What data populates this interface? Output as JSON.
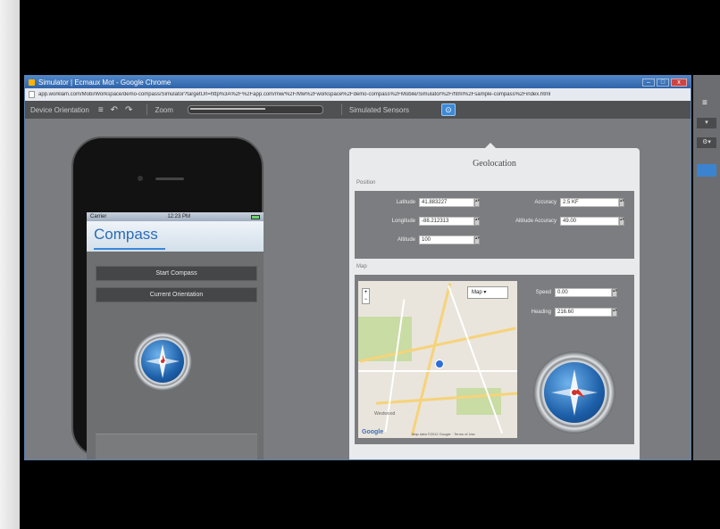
{
  "browser": {
    "title": "Simulator | Ecmaux Mot - Google Chrome",
    "url": "app.worklam.com/Mobi/Workspace/demo-compass/Simulator?targetUrl=http%3A%2F%2Fapp.com/mw/%2F/Mw%2Fworkspace%2Fdemo-compass%2FMobile/Simulator%2F/html%2Fsample-compass%2Findex.html",
    "win_min": "–",
    "win_max": "□",
    "win_close": "x"
  },
  "toolbar": {
    "device_orientation": "Device Orientation",
    "zoom_label": "Zoom",
    "zoom_level": 0.6,
    "simulated_sensors": "Simulated Sensors"
  },
  "phone": {
    "carrier": "Carrier",
    "time": "12:23 PM",
    "app_title": "Compass",
    "start_button": "Start Compass",
    "current_button": "Current Orientation"
  },
  "geolocation": {
    "title": "Geolocation",
    "position_label": "Position",
    "latitude_label": "Latitude",
    "latitude_value": "41.883227",
    "longitude_label": "Longitude",
    "longitude_value": "-88.212313",
    "altitude_label": "Altitude",
    "altitude_value": "100",
    "accuracy_label": "Accuracy",
    "accuracy_value": "2.5 KF",
    "altitude_accuracy_label": "Altitude Accuracy",
    "altitude_accuracy_value": "49.00",
    "map_label": "Map",
    "map_type": "Map",
    "speed_label": "Speed",
    "speed_value": "0.00",
    "heading_label": "Heading",
    "heading_value": "216.60",
    "map_attribution": "Map data ©2012 Google",
    "terms": "Terms of Use",
    "map_place": "Westwood"
  },
  "colors": {
    "accent": "#3b83cf",
    "app_title": "#2a6cb5"
  }
}
